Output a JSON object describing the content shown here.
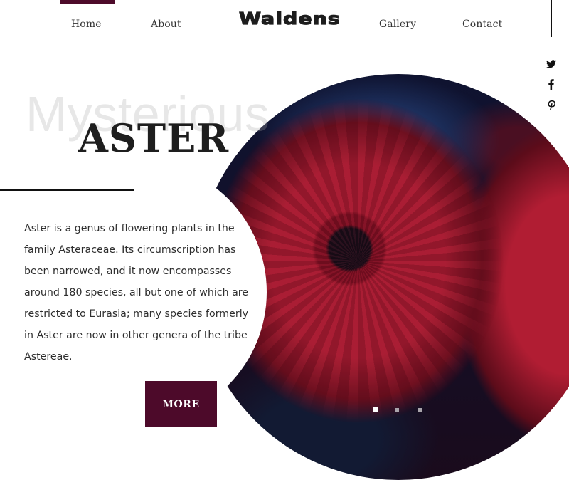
{
  "brand": {
    "logo_text": "Waldens",
    "accent_color": "#4d0a2a"
  },
  "nav": {
    "active": "Home",
    "items": [
      {
        "label": "Home"
      },
      {
        "label": "About"
      },
      {
        "label": "Gallery"
      },
      {
        "label": "Contact"
      }
    ]
  },
  "social": {
    "icons": [
      "twitter-icon",
      "facebook-icon",
      "pinterest-icon"
    ]
  },
  "hero": {
    "watermark": "Mysterious",
    "title": "ASTER",
    "description": "Aster is a genus of flowering plants in the family Asteraceae. Its circumscription has been narrowed, and it now encompasses around 180 species, all but one of which are restricted to Eurasia; many species formerly in Aster are now in other genera of the tribe Astereae.",
    "button_label": "MORE",
    "image_alt": "red aster flowers",
    "slider": {
      "total": 3,
      "active_index": 0
    }
  }
}
